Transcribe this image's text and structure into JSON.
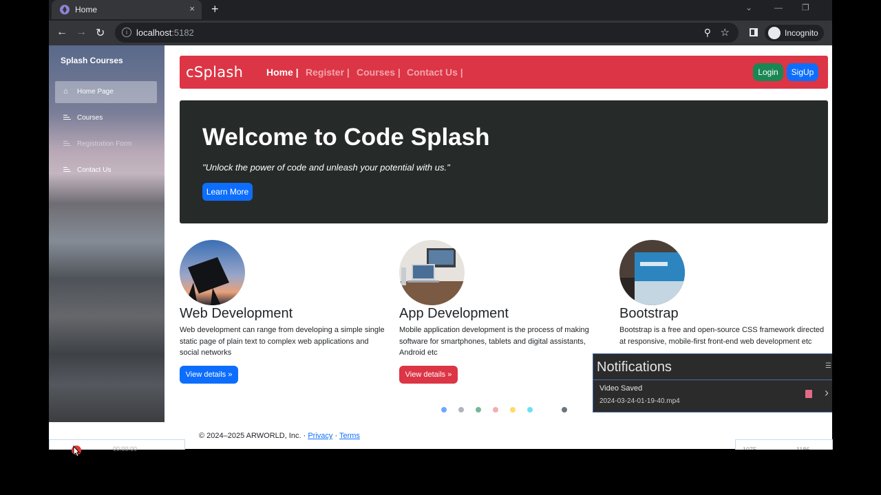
{
  "browser": {
    "tab_title": "Home",
    "tab_close": "×",
    "new_tab": "+",
    "url_host": "localhost",
    "url_port": ":5182",
    "profile_label": "Incognito"
  },
  "sidebar": {
    "title": "Splash Courses",
    "items": [
      {
        "label": "Home Page"
      },
      {
        "label": "Courses"
      },
      {
        "label": "Registration Form"
      },
      {
        "label": "Contact Us"
      }
    ]
  },
  "navbar": {
    "brand": "cSplash",
    "links": [
      "Home |",
      "Register |",
      "Courses |",
      "Contact Us |"
    ],
    "login": "Login",
    "signup": "SigUp"
  },
  "hero": {
    "title": "Welcome to Code Splash",
    "quote": "\"Unlock the power of code and unleash your potential with us.\"",
    "button": "Learn More"
  },
  "cards": [
    {
      "title": "Web Development",
      "text": "Web development can range from developing a simple single static page of plain text to complex web applications and social networks",
      "button": "View details »",
      "button_color": "#0d6efd"
    },
    {
      "title": "App Development",
      "text": "Mobile application development is the process of making software for smartphones, tablets and digital assistants, Android etc",
      "button": "View details »",
      "button_color": "#dc3545"
    },
    {
      "title": "Bootstrap",
      "text": "Bootstrap is a free and open-source CSS framework directed at responsive, mobile-first front-end web development etc",
      "button": "",
      "button_color": ""
    }
  ],
  "carousel_dots": [
    "#6ea8fe",
    "#adb5bd",
    "#75b798",
    "#f1aeb5",
    "#ffda6a",
    "#6edff6",
    "#ffffff",
    "#6c757d"
  ],
  "notification": {
    "heading": "Notifications",
    "title": "Video Saved",
    "filename": "2024-03-24-01-19-40.mp4"
  },
  "footer": {
    "copyright": "© 2024–2025 ARWORLD, Inc. · ",
    "privacy": "Privacy",
    "sep": " · ",
    "terms": "Terms"
  },
  "recorder": {
    "time": "00:00:00",
    "width": "1075",
    "height": "1186"
  },
  "colors": {
    "navbar": "#dc3545",
    "hero_bg": "#262b2a",
    "primary": "#0d6efd",
    "success": "#198754"
  }
}
